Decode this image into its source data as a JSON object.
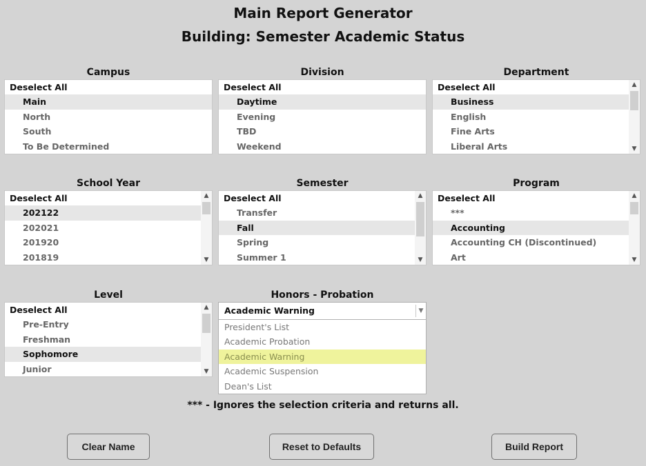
{
  "header": {
    "title": "Main Report Generator",
    "subtitle": "Building: Semester Academic Status"
  },
  "filters": {
    "campus": {
      "label": "Campus",
      "deselect": "Deselect All",
      "items": [
        "Main",
        "North",
        "South",
        "To Be Determined"
      ],
      "selected": "Main"
    },
    "division": {
      "label": "Division",
      "deselect": "Deselect All",
      "items": [
        "Daytime",
        "Evening",
        "TBD",
        "Weekend"
      ],
      "selected": "Daytime"
    },
    "department": {
      "label": "Department",
      "deselect": "Deselect All",
      "items": [
        "Business",
        "English",
        "Fine Arts",
        "Liberal Arts"
      ],
      "selected": "Business"
    },
    "school_year": {
      "label": "School Year",
      "deselect": "Deselect All",
      "items": [
        "202122",
        "202021",
        "201920",
        "201819"
      ],
      "selected": "202122"
    },
    "semester": {
      "label": "Semester",
      "deselect": "Deselect All",
      "items": [
        "Transfer",
        "Fall",
        "Spring",
        "Summer 1"
      ],
      "selected": "Fall"
    },
    "program": {
      "label": "Program",
      "deselect": "Deselect All",
      "items": [
        "***",
        "Accounting",
        "Accounting CH (Discontinued)",
        "Art"
      ],
      "selected": "Accounting"
    },
    "level": {
      "label": "Level",
      "deselect": "Deselect All",
      "items": [
        "Pre-Entry",
        "Freshman",
        "Sophomore",
        "Junior"
      ],
      "selected": "Sophomore"
    }
  },
  "honors": {
    "label": "Honors - Probation",
    "value": "Academic Warning",
    "options": [
      "President's List",
      "Academic Probation",
      "Academic Warning",
      "Academic Suspension",
      "Dean's List"
    ],
    "highlighted": "Academic Warning"
  },
  "footnote": "*** - Ignores the selection criteria and returns all.",
  "buttons": {
    "clear": "Clear Name",
    "reset": "Reset to Defaults",
    "build": "Build Report"
  },
  "icons": {
    "scroll_up": "chevron-up-icon",
    "scroll_down": "chevron-down-icon",
    "dropdown": "chevron-down-icon"
  },
  "colors": {
    "background": "#d4d4d4",
    "selected_row": "#e6e6e6",
    "highlight": "#eff39c"
  }
}
